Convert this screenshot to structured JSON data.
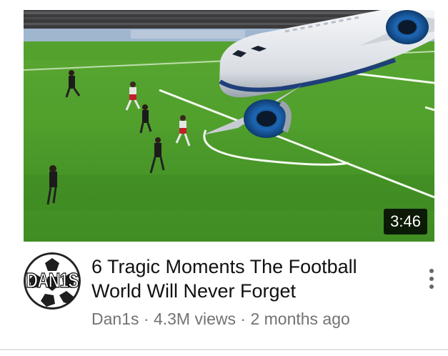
{
  "video": {
    "duration": "3:46",
    "title": "6 Tragic Moments The Football World Will Never Forget",
    "channel": "Dan1s",
    "separator": "·",
    "views": "4.3M views",
    "age": "2 months ago"
  },
  "channel_avatar": {
    "text": "DAN1S",
    "icon": "soccer-ball-icon"
  },
  "menu": {
    "icon": "more-vertical-icon"
  },
  "colors": {
    "pitch": "#4c9a2a",
    "title_text": "#111111",
    "secondary_text": "#737373",
    "duration_bg": "#000000",
    "plane_body": "#eef0f4",
    "engine": "#1b5fa6"
  }
}
